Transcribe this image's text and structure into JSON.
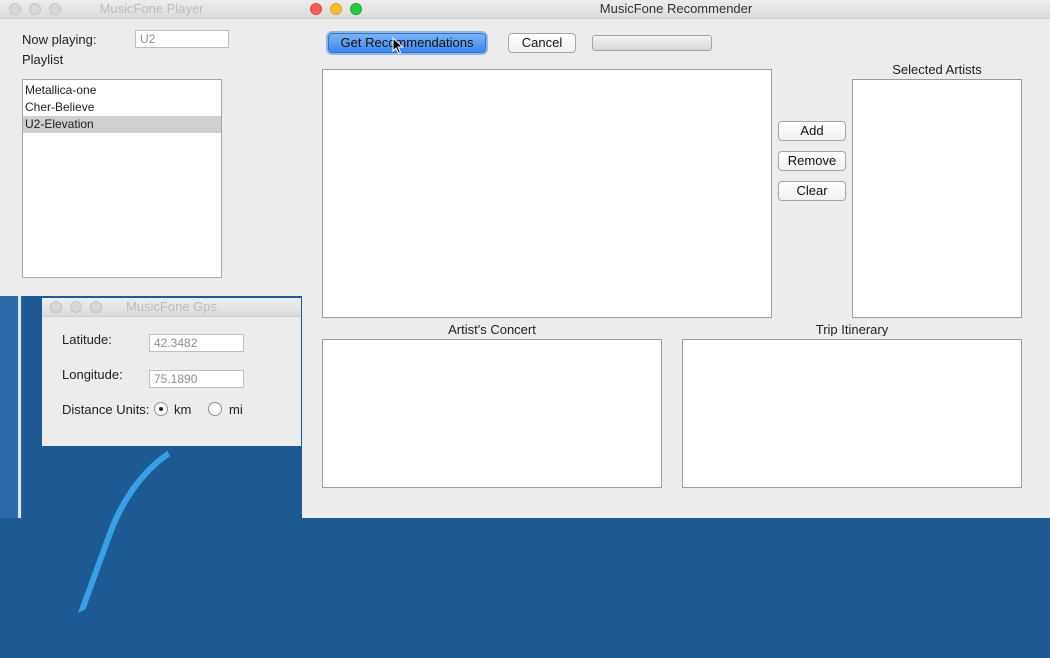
{
  "player": {
    "title": "MusicFone Player",
    "now_playing_label": "Now playing:",
    "now_playing_value": "U2",
    "playlist_label": "Playlist",
    "playlist": [
      {
        "label": "Metallica-one",
        "selected": false
      },
      {
        "label": "Cher-Believe",
        "selected": false
      },
      {
        "label": "U2-Elevation",
        "selected": true
      }
    ]
  },
  "gps": {
    "title": "MusicFone Gps",
    "latitude_label": "Latitude:",
    "latitude_value": "42.3482",
    "longitude_label": "Longitude:",
    "longitude_value": "75.1890",
    "distance_units_label": "Distance Units:",
    "units": [
      {
        "label": "km",
        "selected": true
      },
      {
        "label": "mi",
        "selected": false
      }
    ]
  },
  "recommender": {
    "title": "MusicFone Recommender",
    "get_recommendations_label": "Get Recommendations",
    "cancel_label": "Cancel",
    "progress_fraction": 0,
    "add_label": "Add",
    "remove_label": "Remove",
    "clear_label": "Clear",
    "selected_artists_label": "Selected Artists",
    "artists_concert_label": "Artist's Concert",
    "trip_itinerary_label": "Trip Itinerary"
  },
  "colors": {
    "desktop": "#1e5a93",
    "primary_button": "#3f86ec",
    "selection": "#cfcfcf"
  },
  "icons": {
    "close": "close-icon",
    "minimize": "minimize-icon",
    "zoom": "zoom-icon",
    "cursor": "mouse-pointer-icon"
  }
}
